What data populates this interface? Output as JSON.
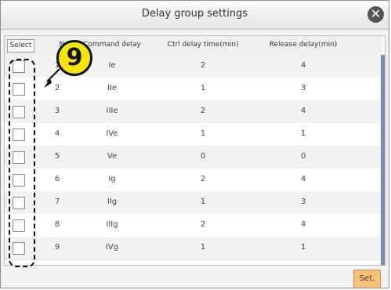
{
  "dialog": {
    "title": "Delay group settings",
    "close_icon": "close-icon",
    "set_label": "Set."
  },
  "table": {
    "select_label": "Select",
    "headers": [
      "No.",
      "Command delay",
      "Ctrl delay time(min)",
      "Release delay(min)"
    ],
    "rows": [
      {
        "no": "1",
        "command_delay": "Ie",
        "ctrl_delay": "2",
        "release_delay": "4"
      },
      {
        "no": "2",
        "command_delay": "IIe",
        "ctrl_delay": "1",
        "release_delay": "3"
      },
      {
        "no": "3",
        "command_delay": "IIIe",
        "ctrl_delay": "2",
        "release_delay": "4"
      },
      {
        "no": "4",
        "command_delay": "IVe",
        "ctrl_delay": "1",
        "release_delay": "1"
      },
      {
        "no": "5",
        "command_delay": "Ve",
        "ctrl_delay": "0",
        "release_delay": "0"
      },
      {
        "no": "6",
        "command_delay": "Ig",
        "ctrl_delay": "2",
        "release_delay": "4"
      },
      {
        "no": "7",
        "command_delay": "IIg",
        "ctrl_delay": "1",
        "release_delay": "3"
      },
      {
        "no": "8",
        "command_delay": "IIIg",
        "ctrl_delay": "2",
        "release_delay": "4"
      },
      {
        "no": "9",
        "command_delay": "IVg",
        "ctrl_delay": "1",
        "release_delay": "1"
      }
    ]
  },
  "annotation": {
    "callout_number": "9"
  },
  "colors": {
    "set_button": "#f7c178",
    "scrollbar": "#7a8fb0",
    "callout": "#f7e600"
  }
}
